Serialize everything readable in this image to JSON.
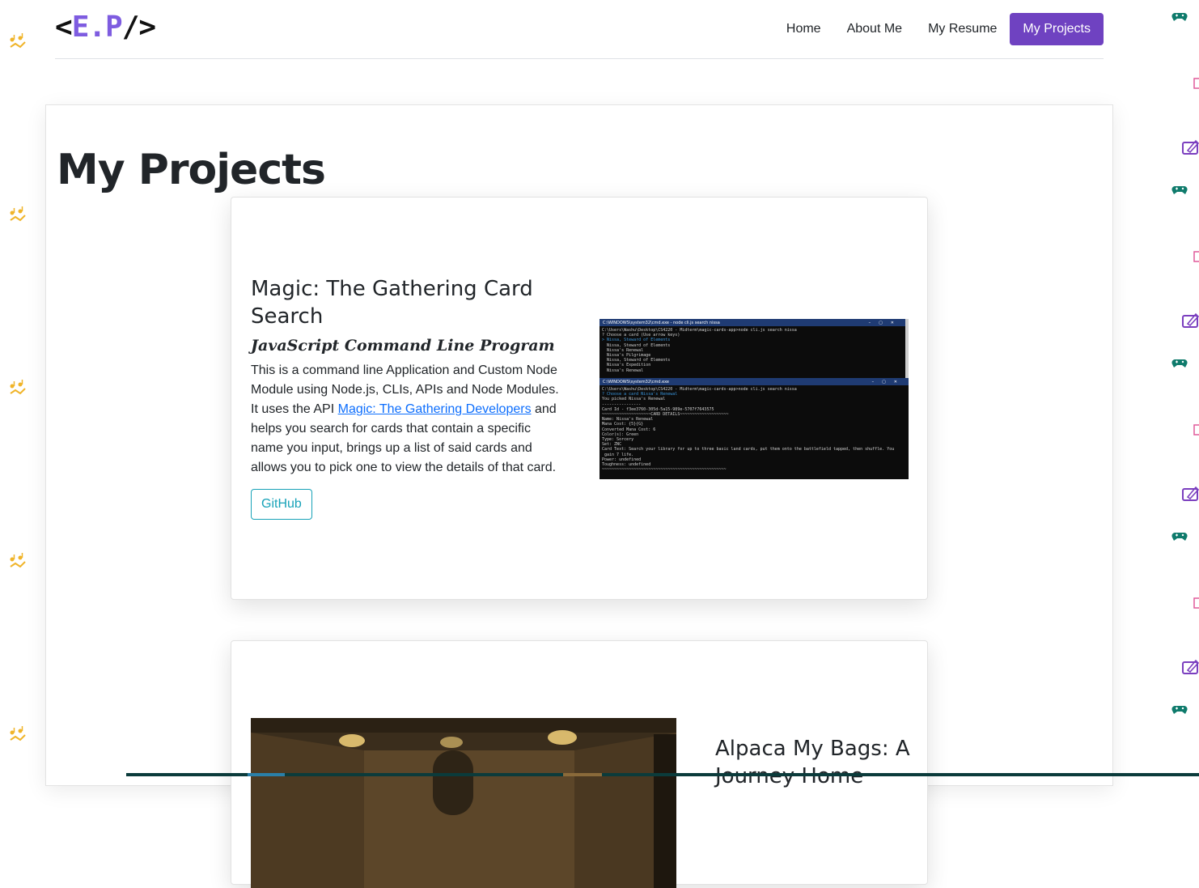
{
  "logo": {
    "open": "<",
    "initials": "E.P",
    "close": "/>"
  },
  "nav": {
    "items": [
      {
        "label": "Home",
        "active": false
      },
      {
        "label": "About Me",
        "active": false
      },
      {
        "label": "My Resume",
        "active": false
      },
      {
        "label": "My Projects",
        "active": true
      }
    ]
  },
  "page": {
    "title": "My Projects"
  },
  "projects": [
    {
      "title": "Magic: The Gathering Card Search",
      "subtitle": "JavaScript Command Line Program",
      "text_before_link": "This is a command line Application and Custom Node Module using Node.js, CLIs, APIs and Node Modules. It uses the API ",
      "link_text": "Magic: The Gathering Developers",
      "text_after_link": " and helps you search for cards that contain a specific name you input, brings up a list of said cards and allows you to pick one to view the details of that card.",
      "button_label": "GitHub",
      "screenshot": {
        "window1_title": "C:\\WINDOWS\\system32\\cmd.exe - node cli.js search nissa",
        "window1_lines": [
          "C:\\Users\\Washu\\Desktop\\CS4220 - Midterm\\magic-cards-app>node cli.js search nissa",
          "? Choose a card (Use arrow keys)",
          "> Nissa, Steward of Elements",
          "  Nissa, Steward of Elements",
          "  Nissa's Renewal",
          "  Nissa's Pilgrimage",
          "  Nissa, Steward of Elements",
          "  Nissa's Expedition",
          "  Nissa's Renewal"
        ],
        "window2_title": "C:\\WINDOWS\\system32\\cmd.exe",
        "window2_lines": [
          "C:\\Users\\Washu\\Desktop\\CS4220 - Midterm\\magic-cards-app>node cli.js search nissa",
          "? Choose a card Nissa's Renewal",
          "You picked Nissa's Renewal",
          "----------------",
          "Card Id - f3ee3760-305d-5a15-989e-5707f7643575",
          "~~~~~~~~~~~~~~~~~~~~CARD DETAILS~~~~~~~~~~~~~~~~~~~~",
          "Name: Nissa's Renewal",
          "Mana Cost: {5}{G}",
          "Converted Mana Cost: 6",
          "Color(s): Green",
          "Type: Sorcery",
          "Set: ZNC",
          "Card Text: Search your library for up to three basic land cards, put them onto the battlefield tapped, then shuffle. You",
          " gain 7 life.",
          "Power: undefined",
          "Toughness: undefined",
          "~~~~~~~~~~~~~~~~~~~~~~~~~~~~~~~~~~~~~~~~~~~~~~~~~~~"
        ]
      }
    },
    {
      "title": "Alpaca My Bags: A Journey Home"
    }
  ],
  "colors": {
    "accent": "#6f42c1",
    "logo_initials": "#7e5ce0",
    "button_outline": "#17a2b8",
    "link": "#0d6efd",
    "deco_music": "#f0b429",
    "deco_gamepad": "#0f7b6c",
    "deco_tablet": "#7b3fbf",
    "deco_pink": "#e05a9a"
  },
  "decorations": {
    "left_icon": "music-notes-icon",
    "right_icons": [
      "gamepad-icon",
      "tablet-pen-icon",
      "pink-device-icon"
    ]
  }
}
